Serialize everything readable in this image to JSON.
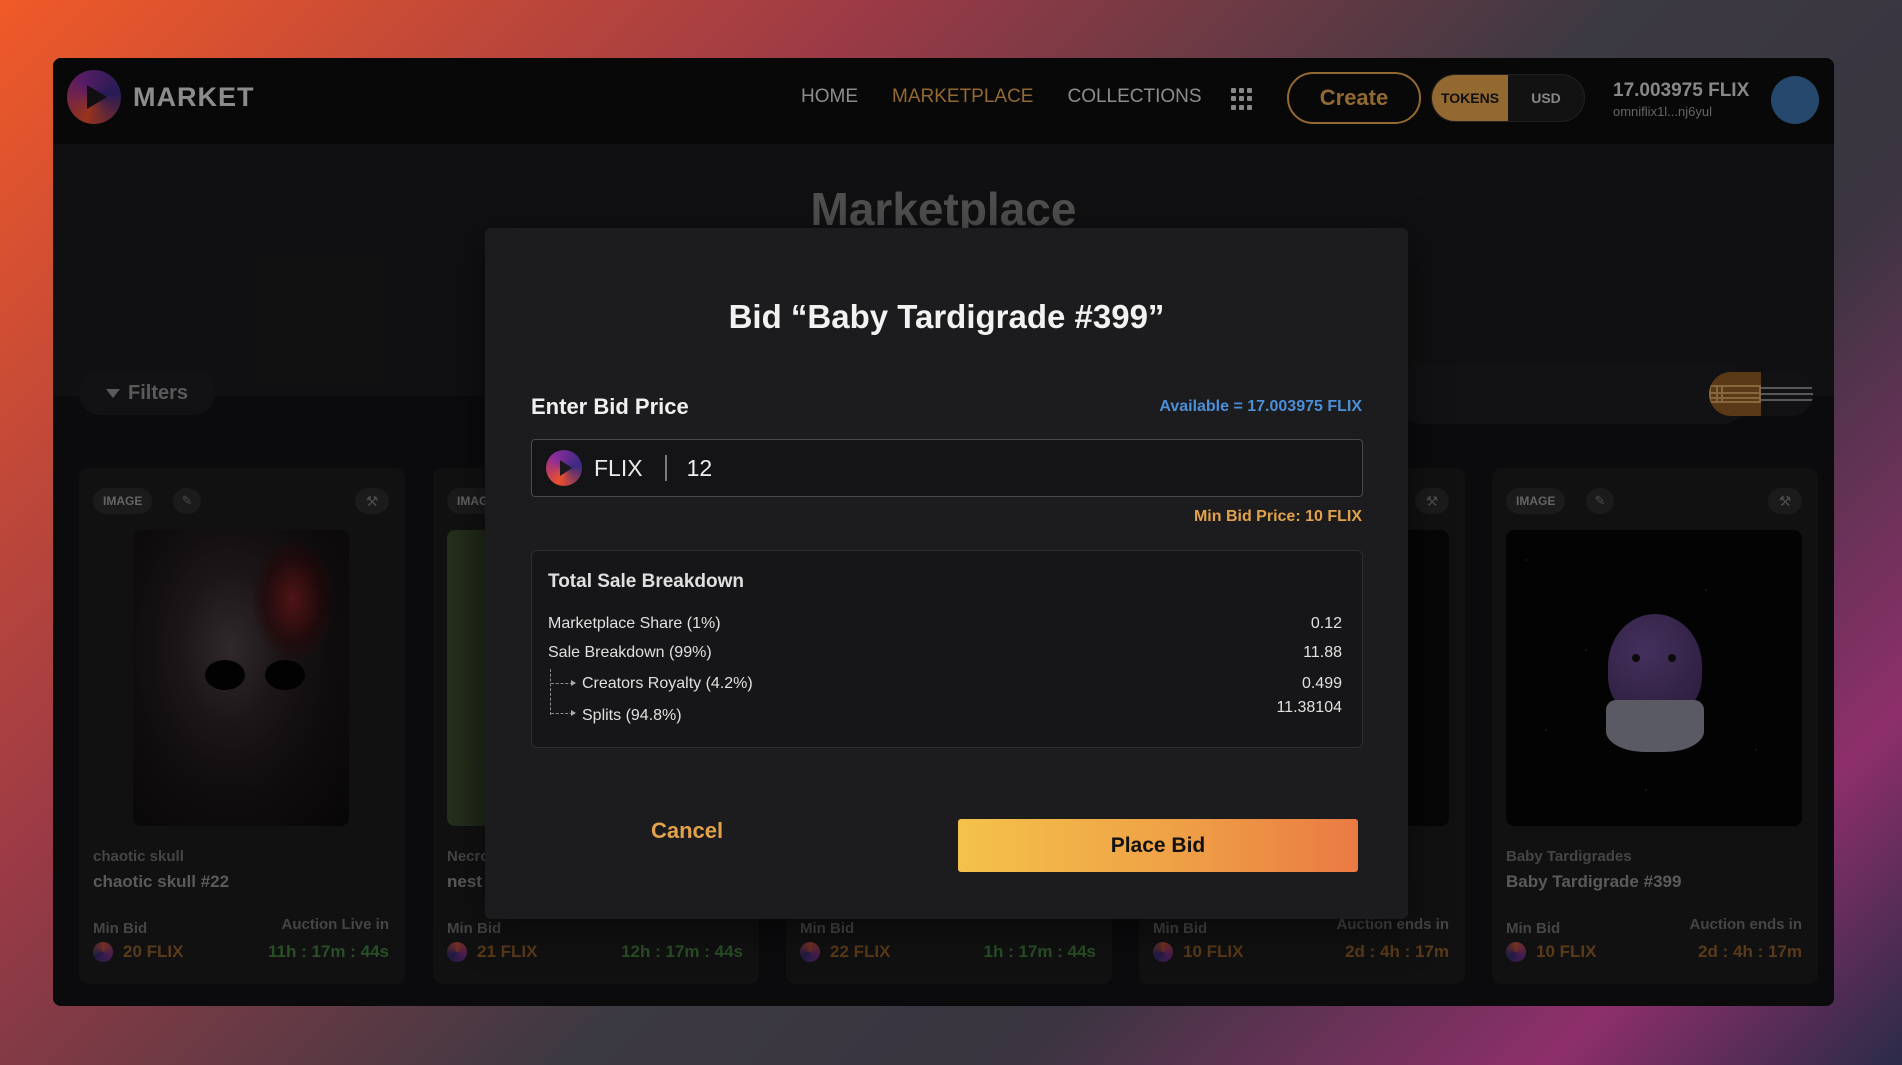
{
  "header": {
    "logo_text": "MARKET",
    "nav": [
      "HOME",
      "MARKETPLACE",
      "COLLECTIONS"
    ],
    "active_nav": "MARKETPLACE",
    "create_label": "Create",
    "toggle": {
      "tokens": "TOKENS",
      "usd": "USD",
      "selected": "TOKENS"
    },
    "wallet": {
      "balance": "17.003975 FLIX",
      "address": "omniflix1l...nj6yul"
    }
  },
  "page": {
    "title": "Marketplace",
    "filters_label": "Filters",
    "view_mode": "grid"
  },
  "cards": [
    {
      "tag": "IMAGE",
      "collection": "chaotic skull",
      "name": "chaotic skull #22",
      "min_bid_label": "Min Bid",
      "price": "20 FLIX",
      "auction_label": "Auction Live in",
      "timer": "11h : 17m : 44s",
      "timer_kind": "live"
    },
    {
      "tag": "IMAGE",
      "collection": "Necro",
      "name": "nest",
      "min_bid_label": "Min Bid",
      "price": "21 FLIX",
      "auction_label": "",
      "timer": "12h : 17m : 44s",
      "timer_kind": "live"
    },
    {
      "tag": "",
      "collection": "",
      "name": "",
      "min_bid_label": "Min Bid",
      "price": "22 FLIX",
      "auction_label": "",
      "timer": "1h : 17m : 44s",
      "timer_kind": "live"
    },
    {
      "tag": "",
      "collection": "",
      "name": "",
      "min_bid_label": "Min Bid",
      "price": "10 FLIX",
      "auction_label": "Auction ends in",
      "timer": "2d : 4h : 17m",
      "timer_kind": "ends"
    },
    {
      "tag": "IMAGE",
      "collection": "Baby Tardigrades",
      "name": "Baby Tardigrade #399",
      "min_bid_label": "Min Bid",
      "price": "10 FLIX",
      "auction_label": "Auction ends in",
      "timer": "2d : 4h : 17m",
      "timer_kind": "ends"
    }
  ],
  "modal": {
    "title": "Bid  “Baby Tardigrade #399”",
    "bid_label": "Enter Bid Price",
    "available": "Available = 17.003975 FLIX",
    "currency": "FLIX",
    "bid_value": "12",
    "min_bid_price": "Min Bid Price: 10 FLIX",
    "breakdown": {
      "title": "Total Sale Breakdown",
      "rows": [
        {
          "label": "Marketplace Share (1%)",
          "value": "0.12"
        },
        {
          "label": "Sale Breakdown (99%)",
          "value": "11.88"
        },
        {
          "label": "Creators Royalty (4.2%)",
          "value": "0.499"
        },
        {
          "label": "Splits (94.8%)",
          "value": "11.38104"
        }
      ]
    },
    "cancel_label": "Cancel",
    "place_bid_label": "Place Bid"
  },
  "colors": {
    "accent": "#e2a24c",
    "available_blue": "#4a8fd8",
    "live_green": "#3f7a3a"
  }
}
